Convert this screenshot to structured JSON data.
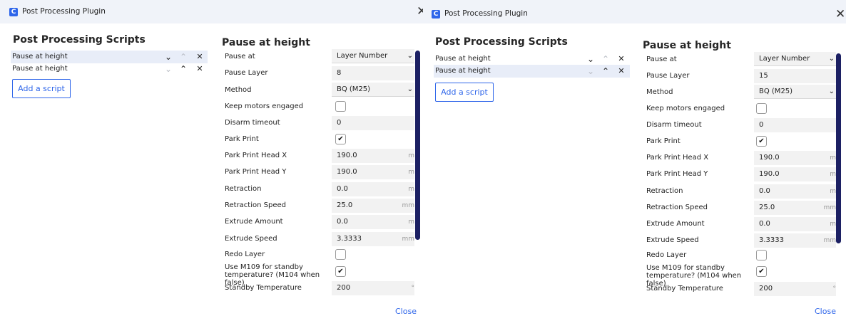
{
  "windows": [
    {
      "title": "Post Processing Plugin",
      "app_icon_letter": "C",
      "close_glyph": "✕",
      "scripts_heading": "Post Processing Scripts",
      "scripts": [
        {
          "label": "Pause at height",
          "selected": true
        },
        {
          "label": "Pause at height",
          "selected": false
        }
      ],
      "add_script_label": "Add a script",
      "settings_title": "Pause at height",
      "settings": {
        "pause_at": {
          "label": "Pause at",
          "value": "Layer Number"
        },
        "pause_layer": {
          "label": "Pause Layer",
          "value": "8"
        },
        "method": {
          "label": "Method",
          "value": "BQ (M25)"
        },
        "keep_motors": {
          "label": "Keep motors engaged",
          "checked": ""
        },
        "disarm_timeout": {
          "label": "Disarm timeout",
          "value": "0"
        },
        "park_print": {
          "label": "Park Print",
          "checked": "✔"
        },
        "park_x": {
          "label": "Park Print Head X",
          "value": "190.0",
          "unit": "m"
        },
        "park_y": {
          "label": "Park Print Head Y",
          "value": "190.0",
          "unit": "m"
        },
        "retraction": {
          "label": "Retraction",
          "value": "0.0",
          "unit": "m"
        },
        "retraction_speed": {
          "label": "Retraction Speed",
          "value": "25.0",
          "unit": "mm"
        },
        "extrude_amount": {
          "label": "Extrude Amount",
          "value": "0.0",
          "unit": "m"
        },
        "extrude_speed": {
          "label": "Extrude Speed",
          "value": "3.3333",
          "unit": "mm"
        },
        "redo_layer": {
          "label": "Redo Layer",
          "checked": ""
        },
        "use_m109": {
          "label": "Use M109 for standby temperature? (M104 when false)",
          "checked": "✔"
        },
        "standby_temp": {
          "label": "Standby Temperature",
          "value": "200",
          "unit": "°"
        }
      },
      "close_label": "Close"
    },
    {
      "title": "Post Processing Plugin",
      "app_icon_letter": "C",
      "close_glyph": "✕",
      "scripts_heading": "Post Processing Scripts",
      "scripts": [
        {
          "label": "Pause at height",
          "selected": false
        },
        {
          "label": "Pause at height",
          "selected": true
        }
      ],
      "add_script_label": "Add a script",
      "settings_title": "Pause at height",
      "settings": {
        "pause_at": {
          "label": "Pause at",
          "value": "Layer Number"
        },
        "pause_layer": {
          "label": "Pause Layer",
          "value": "15"
        },
        "method": {
          "label": "Method",
          "value": "BQ (M25)"
        },
        "keep_motors": {
          "label": "Keep motors engaged",
          "checked": ""
        },
        "disarm_timeout": {
          "label": "Disarm timeout",
          "value": "0"
        },
        "park_print": {
          "label": "Park Print",
          "checked": "✔"
        },
        "park_x": {
          "label": "Park Print Head X",
          "value": "190.0",
          "unit": "m"
        },
        "park_y": {
          "label": "Park Print Head Y",
          "value": "190.0",
          "unit": "m"
        },
        "retraction": {
          "label": "Retraction",
          "value": "0.0",
          "unit": "m"
        },
        "retraction_speed": {
          "label": "Retraction Speed",
          "value": "25.0",
          "unit": "mm"
        },
        "extrude_amount": {
          "label": "Extrude Amount",
          "value": "0.0",
          "unit": "m"
        },
        "extrude_speed": {
          "label": "Extrude Speed",
          "value": "3.3333",
          "unit": "mm"
        },
        "redo_layer": {
          "label": "Redo Layer",
          "checked": ""
        },
        "use_m109": {
          "label": "Use M109 for standby temperature? (M104 when false)",
          "checked": "✔"
        },
        "standby_temp": {
          "label": "Standby Temperature",
          "value": "200",
          "unit": "°"
        }
      },
      "close_label": "Close"
    }
  ],
  "glyphs": {
    "chevron_down": "⌄",
    "chevron_up": "⌃",
    "remove": "✕",
    "dropdown_caret": "⌄"
  },
  "colors": {
    "accent": "#2f66ea",
    "scrollbar": "#1c2063",
    "selected_row": "#e8edf8",
    "titlebar": "#f0f3f9"
  }
}
